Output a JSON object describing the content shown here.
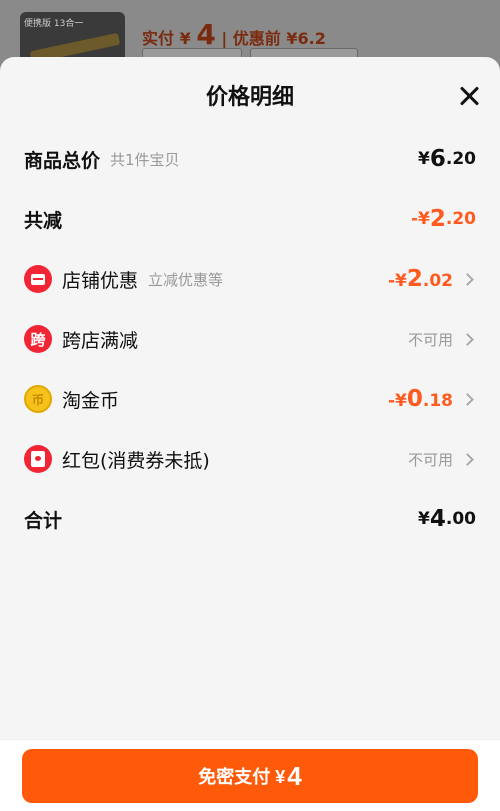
{
  "background": {
    "thumb_tag": "便携版 13合一",
    "paid_label": "实付",
    "paid_currency": "¥",
    "paid_amount": "4",
    "separator": "|",
    "before_discount": "优惠前 ¥6.2"
  },
  "sheet": {
    "title": "价格明细"
  },
  "rows": {
    "goods_total": {
      "label": "商品总价",
      "sub": "共1件宝贝",
      "currency": "¥",
      "int": "6",
      "dec": ".20"
    },
    "total_reduction": {
      "label": "共减",
      "currency": "-¥",
      "int": "2",
      "dec": ".20"
    },
    "store_discount": {
      "label": "店铺优惠",
      "sub": "立减优惠等",
      "currency": "-¥",
      "int": "2",
      "dec": ".02",
      "icon": "store-icon"
    },
    "cross_store": {
      "label": "跨店满减",
      "status": "不可用",
      "icon_text": "跨"
    },
    "taojinbi": {
      "label": "淘金币",
      "currency": "-¥",
      "int": "0",
      "dec": ".18",
      "icon_text": "币"
    },
    "red_packet": {
      "label": "红包(消费券未抵)",
      "status": "不可用",
      "icon": "red-envelope-icon"
    },
    "total": {
      "label": "合计",
      "currency": "¥",
      "int": "4",
      "dec": ".00"
    }
  },
  "footer": {
    "pay_label": "免密支付 ¥",
    "pay_amount": "4"
  },
  "colors": {
    "accent": "#ff5a0a",
    "discount": "#ff5a1f",
    "icon_red": "#f22535"
  }
}
